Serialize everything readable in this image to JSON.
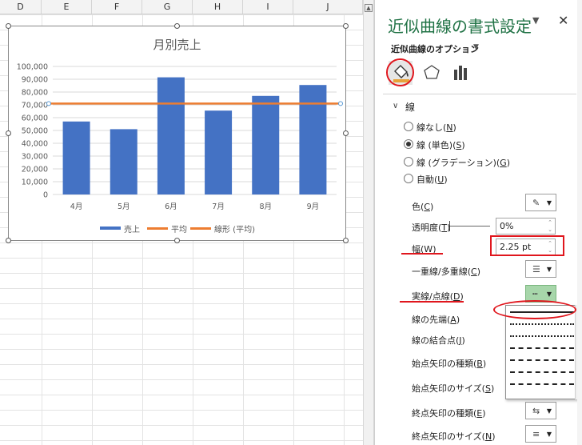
{
  "sheet": {
    "columns": [
      "D",
      "E",
      "F",
      "G",
      "H",
      "I",
      "J"
    ]
  },
  "chart_data": {
    "type": "bar",
    "title": "月別売上",
    "categories": [
      "4月",
      "5月",
      "6月",
      "7月",
      "8月",
      "9月"
    ],
    "series": [
      {
        "name": "売上",
        "values": [
          57000,
          51000,
          91500,
          65500,
          77000,
          85500
        ],
        "color": "#4472c4"
      },
      {
        "name": "平均",
        "values": [
          71000,
          71000,
          71000,
          71000,
          71000,
          71000
        ],
        "color": "#ed7d31",
        "type": "line"
      }
    ],
    "yticks": [
      "100,000",
      "90,000",
      "80,000",
      "70,000",
      "60,000",
      "50,000",
      "40,000",
      "30,000",
      "20,000",
      "10,000",
      "0"
    ],
    "ylim": [
      0,
      100000
    ],
    "legend": [
      "売上",
      "平均",
      "線形 (平均)"
    ],
    "legend_position": "bottom",
    "grid": true
  },
  "pane": {
    "title": "近似曲線の書式設定",
    "options_label": "近似曲線のオプション",
    "tabs": [
      "fill-line",
      "effects",
      "trendline-options"
    ],
    "section_title": "線",
    "line_options": [
      {
        "label": "線なし(",
        "key": "N",
        "selected": false
      },
      {
        "label": "線 (単色)(",
        "key": "S",
        "selected": true
      },
      {
        "label": "線 (グラデーション)(",
        "key": "G",
        "selected": false
      },
      {
        "label": "自動(",
        "key": "U",
        "selected": false
      }
    ],
    "color_label": "色(",
    "color_key": "C",
    "transparency_label": "透明度(",
    "transparency_key": "T",
    "transparency_value": "0%",
    "width_label": "幅(",
    "width_key": "W",
    "width_value": "2.25 pt",
    "compound_label": "一重線/多重線(",
    "compound_key": "C",
    "dash_label": "実線/点線(",
    "dash_key": "D",
    "cap_label": "線の先端(",
    "cap_key": "A",
    "join_label": "線の結合点(",
    "join_key": "J",
    "begin_type_label": "始点矢印の種類(",
    "begin_type_key": "B",
    "begin_size_label": "始点矢印のサイズ(",
    "begin_size_key": "S",
    "end_type_label": "終点矢印の種類(",
    "end_type_key": "E",
    "end_size_label": "終点矢印のサイズ(",
    "end_size_key": "N",
    "close_paren": ")"
  },
  "dash_styles": [
    "solid",
    "round-dot",
    "square-dot",
    "dash",
    "dash-dot",
    "long-dash",
    "long-dash-dot"
  ]
}
